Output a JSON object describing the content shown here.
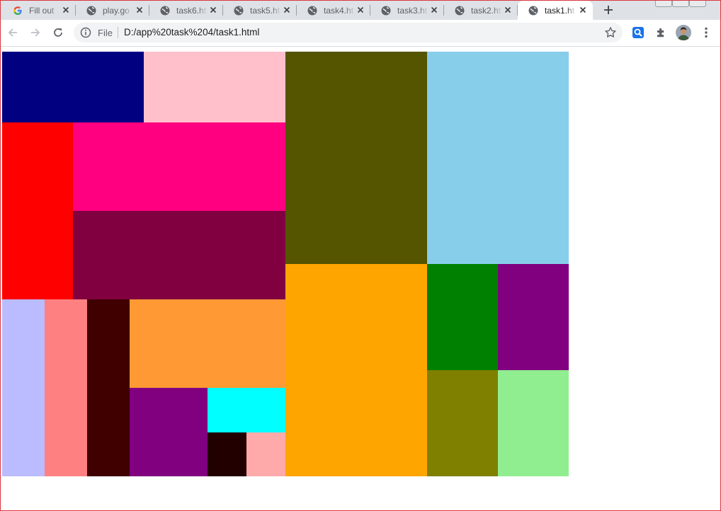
{
  "tabs": [
    {
      "title": "Fill out",
      "icon": "google-icon",
      "active": false
    },
    {
      "title": "play.go",
      "icon": "globe-icon",
      "active": false
    },
    {
      "title": "task6.ht",
      "icon": "globe-icon",
      "active": false
    },
    {
      "title": "task5.ht",
      "icon": "globe-icon",
      "active": false
    },
    {
      "title": "task4.ht",
      "icon": "globe-icon",
      "active": false
    },
    {
      "title": "task3.ht",
      "icon": "globe-icon",
      "active": false
    },
    {
      "title": "task2.ht",
      "icon": "globe-icon",
      "active": false
    },
    {
      "title": "task1.ht",
      "icon": "globe-icon",
      "active": true
    }
  ],
  "toolbar": {
    "back_icon": "back-arrow-icon",
    "forward_icon": "forward-arrow-icon",
    "reload_icon": "reload-icon",
    "site_info_icon": "info-icon",
    "scheme_chip": "File",
    "url": "D:/app%20task%204/task1.html",
    "bookmark_icon": "star-icon",
    "extensions": [
      "search-extension-icon",
      "puzzle-icon",
      "avatar",
      "kebab-menu-icon"
    ]
  },
  "page": {
    "blocks": [
      {
        "name": "navy-block",
        "color": "#000080"
      },
      {
        "name": "pink-block",
        "color": "#ffc0cb"
      },
      {
        "name": "olive-dark-block",
        "color": "#555500"
      },
      {
        "name": "skyblue-block",
        "color": "#87ceeb"
      },
      {
        "name": "red-block",
        "color": "#ff0000"
      },
      {
        "name": "hotpink-block",
        "color": "#ff0080"
      },
      {
        "name": "maroon-block",
        "color": "#800040"
      },
      {
        "name": "lavender-block",
        "color": "#bbbbff"
      },
      {
        "name": "salmon-block",
        "color": "#ff8080"
      },
      {
        "name": "darkred-block",
        "color": "#400000"
      },
      {
        "name": "lightorange-block",
        "color": "#ff9933"
      },
      {
        "name": "purple-block",
        "color": "#800080"
      },
      {
        "name": "cyan-block",
        "color": "#00ffff"
      },
      {
        "name": "black-brown-block",
        "color": "#220000"
      },
      {
        "name": "light-pink-block",
        "color": "#ffaaaa"
      },
      {
        "name": "orange-block",
        "color": "#ffa500"
      },
      {
        "name": "green-block",
        "color": "#008000"
      },
      {
        "name": "purple-right-block",
        "color": "#800080"
      },
      {
        "name": "olive-block",
        "color": "#808000"
      },
      {
        "name": "lightgreen-block",
        "color": "#90ee90"
      }
    ]
  }
}
